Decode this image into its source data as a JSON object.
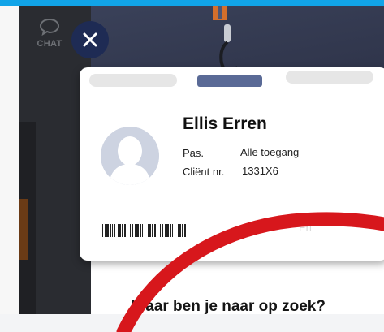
{
  "sidebar": {
    "chat_label": "CHAT"
  },
  "card": {
    "name": "Ellis Erren",
    "pas_label": "Pas.",
    "pas_value": "Alle toegang",
    "client_label": "Cliënt nr.",
    "client_value": "1331X6",
    "faint_text": "Eri"
  },
  "dialog": {
    "question": "Waar ben je naar op zoek?"
  },
  "colors": {
    "topbar": "#11a4e8",
    "close_button": "#1e2b54",
    "accent_red": "#d7171c"
  },
  "icons": {
    "chat": "chat-bubble-icon",
    "close": "close-icon"
  }
}
